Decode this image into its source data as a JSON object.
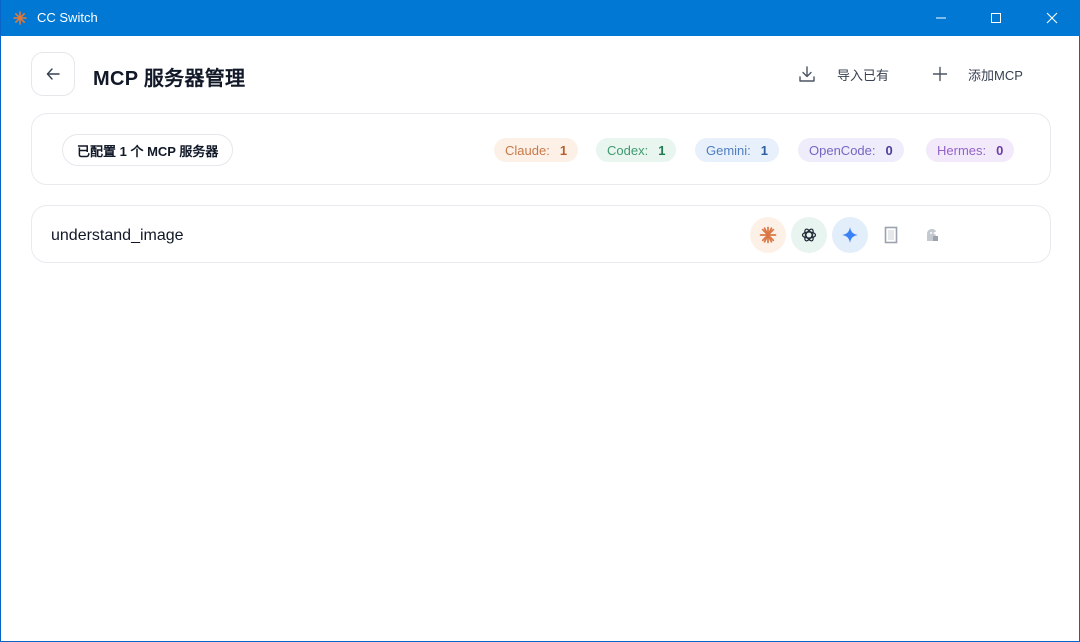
{
  "window": {
    "title": "CC Switch",
    "accent": "#0078d4",
    "icons": [
      "app-logo-icon",
      "minimize-icon",
      "maximize-icon",
      "close-icon"
    ]
  },
  "header": {
    "title": "MCP 服务器管理",
    "back_icon": "arrow-left-icon",
    "import_label": "导入已有",
    "add_label": "添加MCP"
  },
  "summary": {
    "configured_text": "已配置 1 个 MCP 服务器",
    "badges": [
      {
        "name": "Claude:",
        "count": "1",
        "color": "#c8794a"
      },
      {
        "name": "Codex:",
        "count": "1",
        "color": "#3f9a6f"
      },
      {
        "name": "Gemini:",
        "count": "1",
        "color": "#4f7fc0"
      },
      {
        "name": "OpenCode:",
        "count": "0",
        "color": "#7566c4"
      },
      {
        "name": "Hermes:",
        "count": "0",
        "color": "#9462c9"
      }
    ]
  },
  "servers": [
    {
      "name": "understand_image",
      "apps": [
        {
          "app": "Claude",
          "enabled": true,
          "icon": "claude-icon"
        },
        {
          "app": "Codex",
          "enabled": true,
          "icon": "openai-icon"
        },
        {
          "app": "Gemini",
          "enabled": true,
          "icon": "gemini-icon"
        },
        {
          "app": "OpenCode",
          "enabled": false,
          "icon": "opencode-icon"
        },
        {
          "app": "Hermes",
          "enabled": false,
          "icon": "hermes-icon"
        }
      ]
    }
  ]
}
